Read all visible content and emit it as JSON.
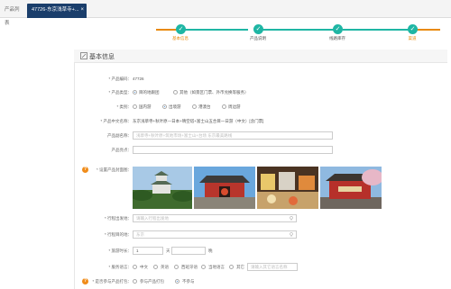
{
  "tabs": {
    "list_label": "产品列表",
    "active_label": "47726-东京浅草寺+...",
    "close": "×"
  },
  "steps": [
    {
      "label": "基本信息",
      "active": true
    },
    {
      "label": "产品说明",
      "active": false
    },
    {
      "label": "线路库存",
      "active": false
    },
    {
      "label": "渠道",
      "active": false
    }
  ],
  "colors": {
    "step_teal": "#1fb6a4",
    "step_orange": "#e8890a",
    "tab_dark": "#1a3e6b",
    "warn": "#f08c1a"
  },
  "panel": {
    "title": "基本信息"
  },
  "form": {
    "product_id_label": "* 产品编码：",
    "product_id_value": "47726",
    "product_type_label": "* 产品类型：",
    "product_type_options": [
      "目的地跟团",
      "其他（如景区门票、外币兑换等服务）"
    ],
    "tour_label": "* 类别：",
    "tour_options": [
      "国内游",
      "出境游",
      "港澳台",
      "周边游"
    ],
    "name_label": "* 产品中文名称：",
    "name_value": "东京浅草寺+秋叶原—日本+晴空塔+富士山五合目一日游（中文）[含门票]",
    "subname_label": "产品副名称：",
    "subname_placeholder": "浅草寺+秋叶原+筑地市场+富士山+台场 东京最美路线",
    "feature_label": "产品亮点：",
    "feature_placeholder": "",
    "photos_label": "* 设置产品封面图：",
    "dep_label": "* 行程出发地：",
    "dep_placeholder": "请输入行程出发地",
    "dest_label": "* 行程目的地：",
    "dest_placeholder": "东京",
    "duration_label": "* 旅游时长：",
    "duration_days_value": "1",
    "duration_days_unit": "天",
    "duration_nights_unit": "晚",
    "service_label": "* 服务语言：",
    "service_options": [
      "中文",
      "英语",
      "西班牙语",
      "当地语言",
      "其它"
    ],
    "service_other_placeholder": "请输入其它语言名称",
    "selfprice_label": "* 是否参与产品打包：",
    "selfprice_options": [
      "参与产品打包",
      "不参与"
    ]
  }
}
